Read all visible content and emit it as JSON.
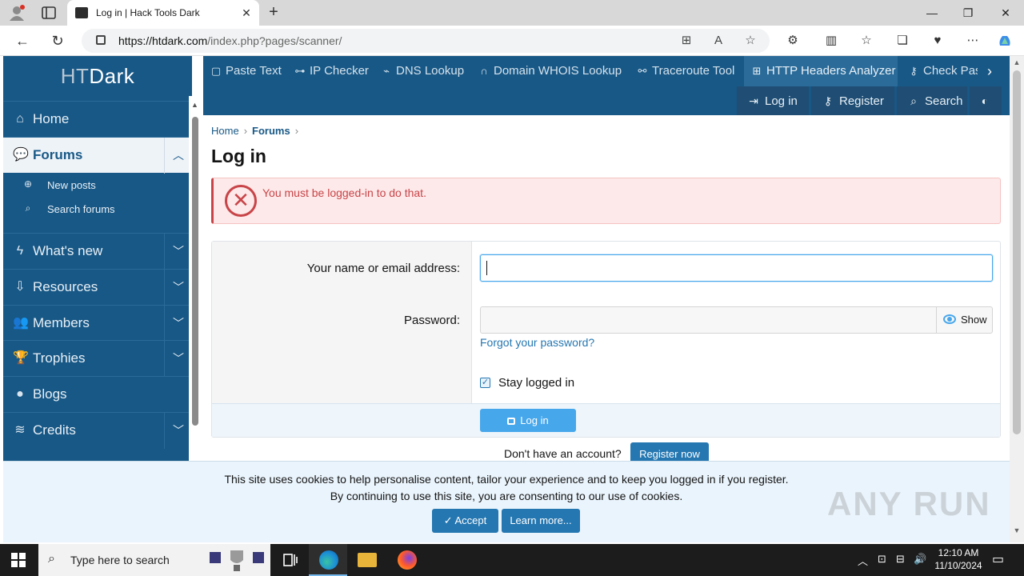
{
  "browser": {
    "tab_title": "Log in | Hack Tools Dark",
    "url_domain": "https://htdark.com",
    "url_path": "/index.php?pages/scanner/"
  },
  "site": {
    "logo_ht": "HT",
    "logo_dark": "Dark"
  },
  "sidebar": {
    "items": [
      {
        "label": "Home",
        "icon": "home-icon"
      },
      {
        "label": "Forums",
        "icon": "forums-icon"
      },
      {
        "label": "What's new",
        "icon": "bolt-icon"
      },
      {
        "label": "Resources",
        "icon": "download-icon"
      },
      {
        "label": "Members",
        "icon": "users-icon"
      },
      {
        "label": "Trophies",
        "icon": "trophy-icon"
      },
      {
        "label": "Blogs",
        "icon": "blog-icon"
      },
      {
        "label": "Credits",
        "icon": "coins-icon"
      }
    ],
    "subitems": [
      {
        "label": "New posts",
        "icon": "search-plus-icon"
      },
      {
        "label": "Search forums",
        "icon": "search-icon"
      }
    ]
  },
  "topnav": {
    "tabs": [
      {
        "label": "Paste Text"
      },
      {
        "label": "IP Checker"
      },
      {
        "label": "DNS Lookup"
      },
      {
        "label": "Domain WHOIS Lookup"
      },
      {
        "label": "Traceroute Tool"
      },
      {
        "label": "HTTP Headers Analyzer"
      },
      {
        "label": "Check Pas"
      }
    ],
    "account": {
      "login": "Log in",
      "register": "Register",
      "search": "Search"
    }
  },
  "breadcrumb": {
    "home": "Home",
    "forums": "Forums"
  },
  "page": {
    "title": "Log in",
    "error": "You must be logged-in to do that."
  },
  "form": {
    "name_label": "Your name or email address:",
    "name_value": "",
    "password_label": "Password:",
    "show_label": "Show",
    "forgot_link": "Forgot your password?",
    "stay_logged_in": "Stay logged in",
    "stay_logged_in_checked": true,
    "submit": "Log in"
  },
  "register": {
    "prompt": "Don't have an account?",
    "button": "Register now"
  },
  "cookie": {
    "line1": "This site uses cookies to help personalise content, tailor your experience and to keep you logged in if you register.",
    "line2": "By continuing to use this site, you are consenting to our use of cookies.",
    "accept": "Accept",
    "learn_more": "Learn more..."
  },
  "watermark": "ANY RUN",
  "taskbar": {
    "search_placeholder": "Type here to search",
    "time": "12:10 AM",
    "date": "11/10/2024"
  },
  "colors": {
    "brand": "#185886",
    "link": "#2577b1",
    "error": "#c84448",
    "button": "#47a7eb"
  }
}
